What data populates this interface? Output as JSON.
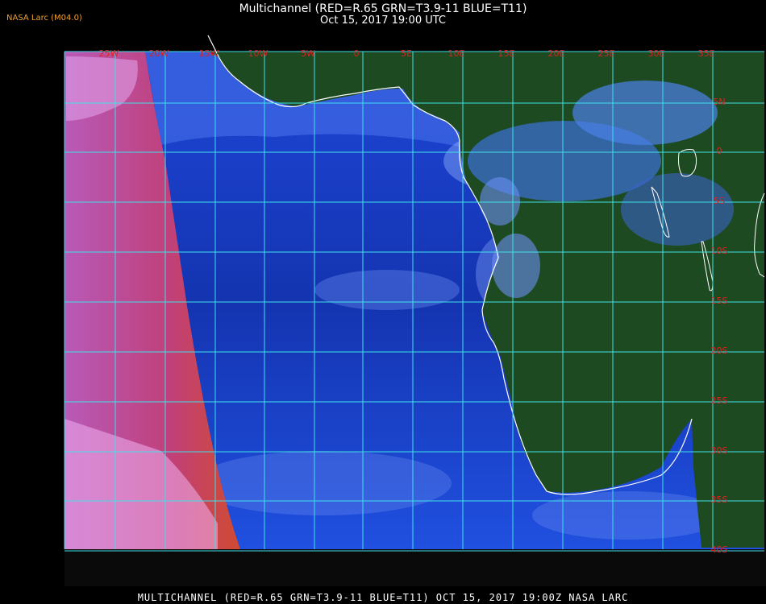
{
  "header": {
    "title": "Multichannel (RED=R.65 GRN=T3.9-11 BLUE=T11)",
    "subtitle": "Oct 15, 2017 19:00 UTC",
    "credit": "NASA Larc (M04.0)"
  },
  "map": {
    "lon_labels": [
      "25W",
      "20W",
      "15W",
      "10W",
      "5W",
      "0",
      "5E",
      "10E",
      "15E",
      "20E",
      "25E",
      "30E",
      "35E"
    ],
    "lat_labels": [
      "5N",
      "0",
      "5S",
      "10S",
      "15S",
      "20S",
      "25S",
      "30S",
      "35S",
      "40S"
    ],
    "colors": {
      "grid": "#40e0e8",
      "label": "#e02020",
      "coast": "#ffffff",
      "ocean": "#1a3cc8",
      "land": "#124a1e",
      "cloud_low": "#e070d0",
      "cloud_high": "#8fb0ff"
    }
  },
  "footer": {
    "text": "MULTICHANNEL (RED=R.65 GRN=T3.9-11 BLUE=T11) OCT 15, 2017 19:00Z   NASA LARC"
  }
}
